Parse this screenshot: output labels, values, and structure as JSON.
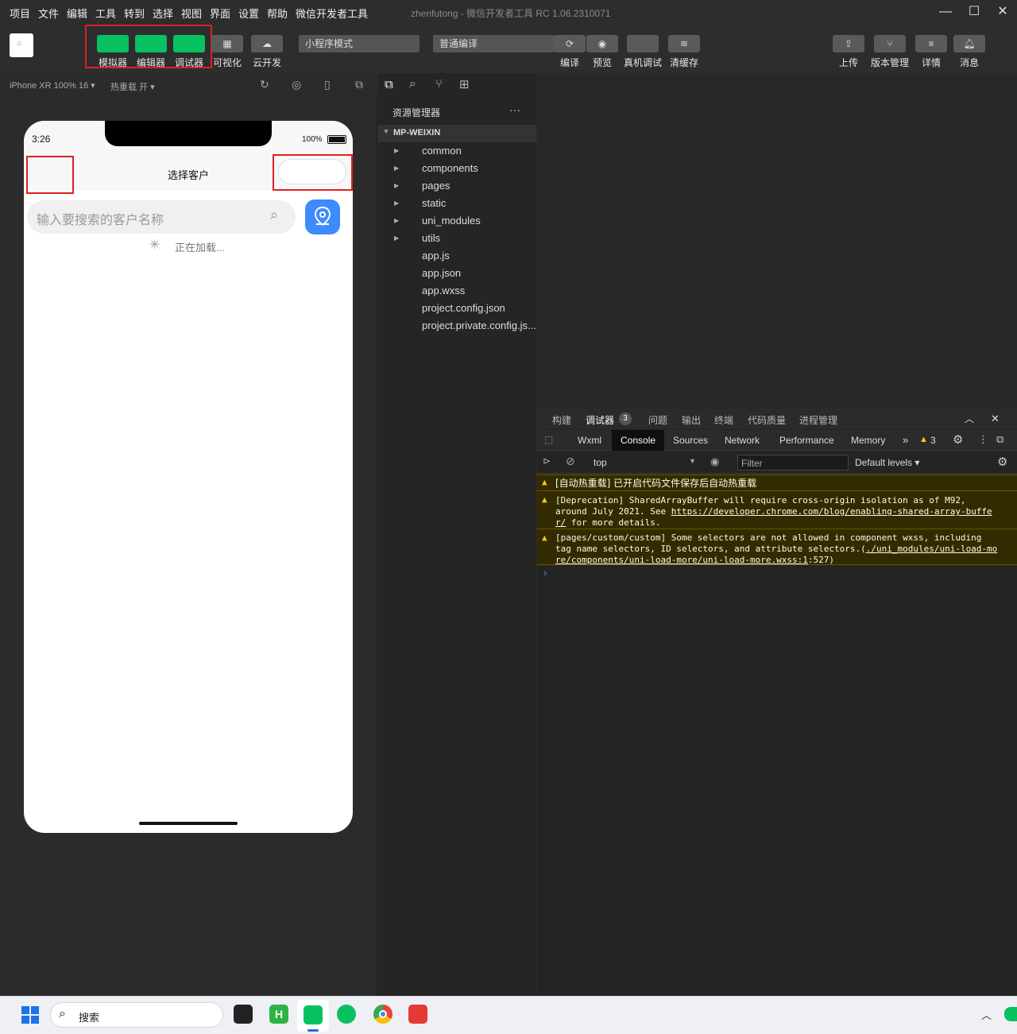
{
  "titlebar": {
    "menus": [
      "项目",
      "文件",
      "编辑",
      "工具",
      "转到",
      "选择",
      "视图",
      "界面",
      "设置",
      "帮助",
      "微信开发者工具"
    ],
    "title": "zhenfutong - 微信开发者工具 RC 1.06.2310071"
  },
  "toolbar": {
    "simulator": "模拟器",
    "editor": "编辑器",
    "debugger": "调试器",
    "visual": "可视化",
    "cloud": "云开发",
    "mode": "小程序模式",
    "compile_mode": "普通编译",
    "compile": "编译",
    "preview": "预览",
    "real_debug": "真机调试",
    "clear_cache": "清缓存",
    "upload": "上传",
    "version": "版本管理",
    "details": "详情",
    "messages": "消息"
  },
  "simulator": {
    "device": "iPhone XR 100% 16 ▾",
    "hot_reload": "热重载 开 ▾",
    "time": "3:26",
    "battery": "100%",
    "nav_title": "选择客户",
    "search_placeholder": "输入要搜索的客户名称",
    "loading": "正在加载..."
  },
  "explorer": {
    "title": "资源管理器",
    "more": "···",
    "root": "MP-WEIXIN",
    "folders": [
      "common",
      "components",
      "pages",
      "static",
      "uni_modules",
      "utils"
    ],
    "files": [
      "app.js",
      "app.json",
      "app.wxss",
      "project.config.json",
      "project.private.config.js..."
    ]
  },
  "devtools": {
    "top_tabs": [
      "构建",
      "调试器",
      "问题",
      "输出",
      "终端",
      "代码质量",
      "进程管理"
    ],
    "debugger_badge": "3",
    "panel_tabs": [
      "Wxml",
      "Console",
      "Sources",
      "Network",
      "Performance",
      "Memory"
    ],
    "more_tabs": "»",
    "warn_count": "3",
    "context": "top",
    "filter_placeholder": "Filter",
    "levels": "Default levels ▾",
    "messages": [
      {
        "text": "[自动热重载] 已开启代码文件保存后自动热重载"
      },
      {
        "text_a": "[Deprecation] SharedArrayBuffer will require cross-origin isolation as of M92,",
        "text_b": "around July 2021. See ",
        "link": "https://developer.chrome.com/blog/enabling-shared-array-buffe",
        "link2": "r/",
        "text_c": " for more details."
      },
      {
        "text_a": "[pages/custom/custom] Some selectors are not allowed in component wxss, including",
        "text_b": "tag name selectors, ID selectors, and attribute selectors.(",
        "link": "./uni_modules/uni-load-mo",
        "link2": "re/components/uni-load-more/uni-load-more.wxss:1",
        "text_c": ":527)"
      }
    ],
    "prompt": "›"
  },
  "taskbar": {
    "search": "搜索"
  },
  "colors": {
    "accent_green": "#07c160",
    "highlight_red": "#e02020",
    "map_button_blue": "#3d8bfd",
    "warning_bg": "#332b00"
  }
}
